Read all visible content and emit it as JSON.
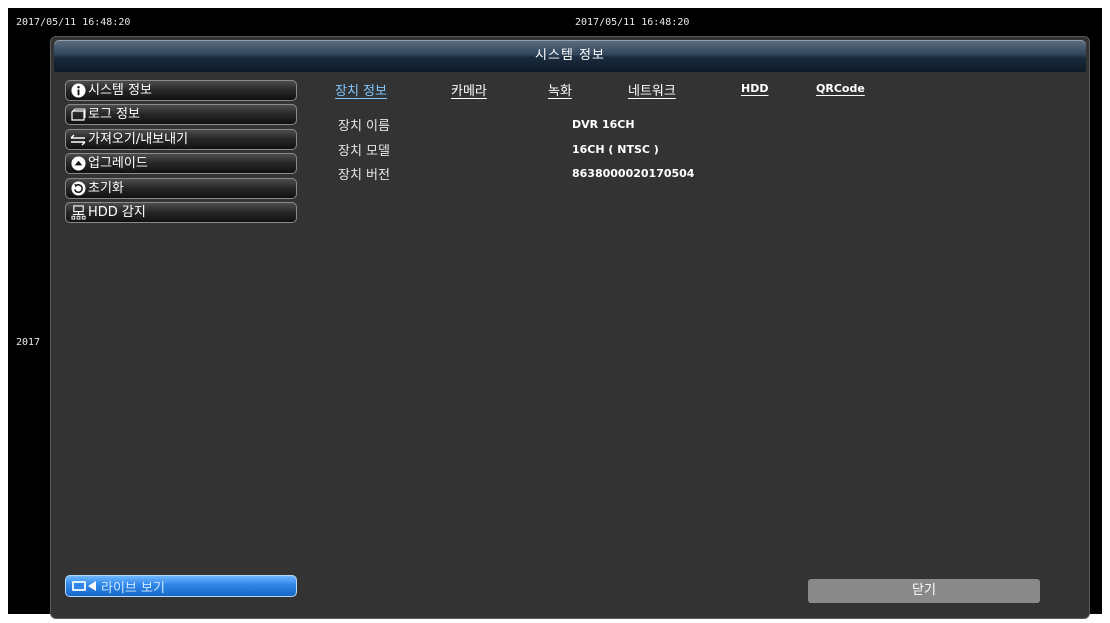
{
  "timestamps": {
    "left": "2017/05/11 16:48:20",
    "center": "2017/05/11 16:48:20",
    "side": "2017"
  },
  "window": {
    "title": "시스템 정보"
  },
  "sidebar": {
    "items": [
      {
        "label": "시스템 정보",
        "icon": "info-icon"
      },
      {
        "label": "로그 정보",
        "icon": "log-icon"
      },
      {
        "label": "가져오기/내보내기",
        "icon": "import-export-icon"
      },
      {
        "label": "업그레이드",
        "icon": "upgrade-icon"
      },
      {
        "label": "초기화",
        "icon": "reset-icon"
      },
      {
        "label": "HDD 감지",
        "icon": "hdd-icon"
      }
    ],
    "live_view": {
      "label": "라이브 보기",
      "icon": "live-view-icon"
    }
  },
  "tabs": [
    {
      "label": "장치 정보",
      "active": true
    },
    {
      "label": "카메라",
      "active": false
    },
    {
      "label": "녹화",
      "active": false
    },
    {
      "label": "네트워크",
      "active": false
    },
    {
      "label": "HDD",
      "active": false
    },
    {
      "label": "QRCode",
      "active": false
    }
  ],
  "device_info": {
    "rows": [
      {
        "label": "장치 이름",
        "value": "DVR 16CH"
      },
      {
        "label": "장치 모델",
        "value": "16CH ( NTSC )"
      },
      {
        "label": "장치 버전",
        "value": "8638000020170504"
      }
    ]
  },
  "footer": {
    "close_label": "닫기"
  },
  "colors": {
    "active_tab": "#7fc6ff",
    "live_button": "#2e86e8",
    "panel_bg": "#333333"
  }
}
